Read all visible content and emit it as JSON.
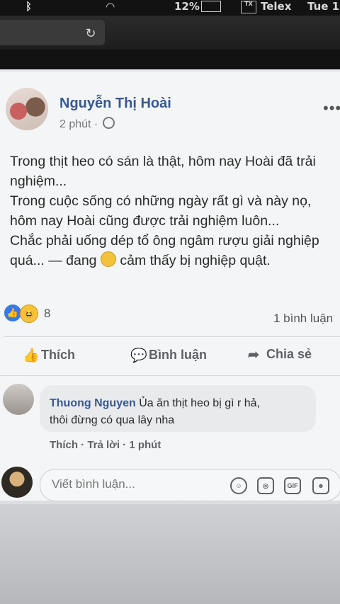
{
  "system": {
    "battery": "12%",
    "input_icon_label": "TX",
    "input_method": "Telex",
    "clock": "Tue 1"
  },
  "post": {
    "author": "Nguyễn Thị Hoài",
    "time": "2 phút ·",
    "more": "•••",
    "lines": [
      "Trong thịt heo có sán là thật, hôm nay Hoài đã trải",
      "nghiệm...",
      "Trong cuộc sống có những ngày rất gì và này nọ,",
      "hôm nay Hoài cũng được trải nghiệm luôn...",
      "Chắc phải uống dép tổ ông ngâm rượu giải nghiệp"
    ],
    "last_line_start": "quá... — đang",
    "last_line_end": "cảm thấy bị nghiệp quật.",
    "reactions_count": "8",
    "comments_count": "1 bình luận"
  },
  "actions": {
    "like": "Thích",
    "comment": "Bình luận",
    "share": "Chia sẻ"
  },
  "comment": {
    "author": "Thuong Nguyen",
    "text_inline": "Ủa ăn thịt heo bị gì r hả,",
    "text_line2": "thôi đừng có qua lây nha",
    "actions": "Thích · Trả lời · 1 phút"
  },
  "composer": {
    "placeholder": "Viết bình luận...",
    "gif": "GIF"
  }
}
